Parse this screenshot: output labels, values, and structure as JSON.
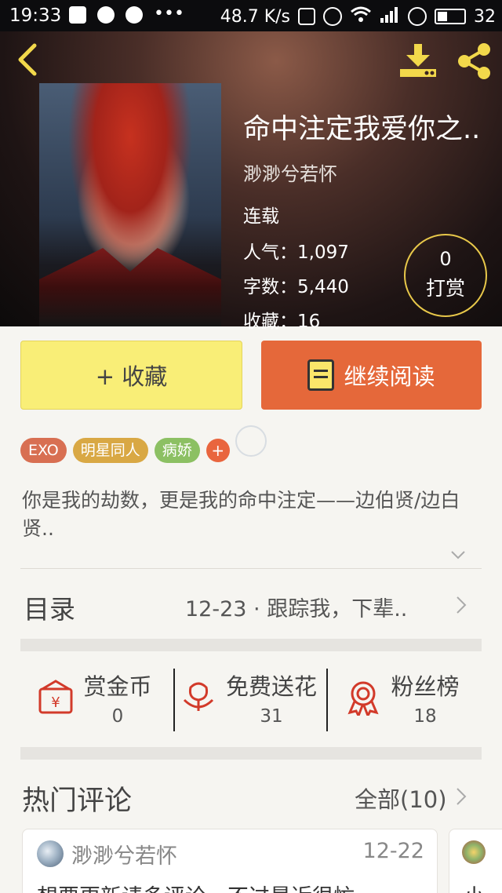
{
  "status_bar": {
    "time": "19:33",
    "speed": "48.7 K/s",
    "battery": "32"
  },
  "book": {
    "title": "命中注定我爱你之..",
    "author": "渺渺兮若怀",
    "status": "连载",
    "popularity_label": "人气：",
    "popularity": "1,097",
    "words_label": "字数：",
    "words": "5,440",
    "favorites_label": "收藏：",
    "favorites": "16"
  },
  "tip": {
    "count": "0",
    "label": "打赏"
  },
  "actions": {
    "collect_label": "+ 收藏",
    "read_label": "继续阅读"
  },
  "tags": [
    {
      "label": "EXO",
      "color": "#d86f52"
    },
    {
      "label": "明星同人",
      "color": "#d9a844"
    },
    {
      "label": "病娇",
      "color": "#8cc063"
    }
  ],
  "tag_add": "+",
  "intro": "你是我的劫数，更是我的命中注定——边伯贤/边白贤..",
  "toc": {
    "label": "目录",
    "latest": "12-23 · 跟踪我，下辈.."
  },
  "metrics": [
    {
      "label": "赏金币",
      "value": "0"
    },
    {
      "label": "免费送花",
      "value": "31"
    },
    {
      "label": "粉丝榜",
      "value": "18"
    }
  ],
  "hot_comments": {
    "title": "热门评论",
    "all_label": "全部(10)"
  },
  "comments": [
    {
      "user": "渺渺兮若怀",
      "date": "12-22",
      "text": "想要更新请多评论，不过最近很忙"
    },
    {
      "user": "",
      "date": "",
      "text": "小"
    }
  ],
  "colors": {
    "accent_yellow": "#f9ee77",
    "accent_orange": "#e5683a",
    "icon_red": "#d23a2a",
    "ring_gold": "#e8c84a"
  }
}
